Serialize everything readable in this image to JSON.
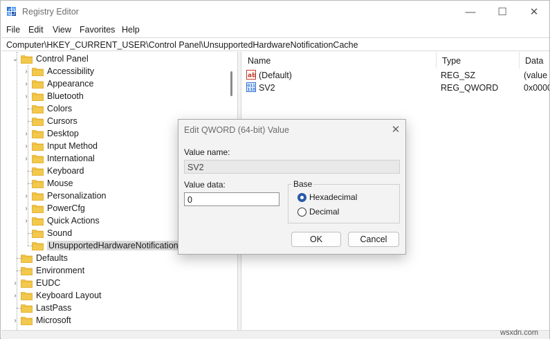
{
  "window": {
    "title": "Registry Editor",
    "controls": {
      "minimize": "—",
      "maximize": "☐",
      "close": "✕"
    }
  },
  "menu": [
    "File",
    "Edit",
    "View",
    "Favorites",
    "Help"
  ],
  "address": "Computer\\HKEY_CURRENT_USER\\Control Panel\\UnsupportedHardwareNotificationCache",
  "tree": {
    "parent": "Control Panel",
    "children": [
      {
        "label": "Accessibility",
        "expandable": true
      },
      {
        "label": "Appearance",
        "expandable": true
      },
      {
        "label": "Bluetooth",
        "expandable": true
      },
      {
        "label": "Colors",
        "expandable": false
      },
      {
        "label": "Cursors",
        "expandable": false
      },
      {
        "label": "Desktop",
        "expandable": true
      },
      {
        "label": "Input Method",
        "expandable": true
      },
      {
        "label": "International",
        "expandable": true
      },
      {
        "label": "Keyboard",
        "expandable": false
      },
      {
        "label": "Mouse",
        "expandable": false
      },
      {
        "label": "Personalization",
        "expandable": true
      },
      {
        "label": "PowerCfg",
        "expandable": true
      },
      {
        "label": "Quick Actions",
        "expandable": true
      },
      {
        "label": "Sound",
        "expandable": false
      },
      {
        "label": "UnsupportedHardwareNotificationC",
        "expandable": false,
        "selected": true
      }
    ],
    "siblings": [
      {
        "label": "Defaults",
        "expandable": false
      },
      {
        "label": "Environment",
        "expandable": false
      },
      {
        "label": "EUDC",
        "expandable": true
      },
      {
        "label": "Keyboard Layout",
        "expandable": true
      },
      {
        "label": "LastPass",
        "expandable": false
      },
      {
        "label": "Microsoft",
        "expandable": true
      }
    ]
  },
  "values_pane": {
    "headers": {
      "name": "Name",
      "type": "Type",
      "data": "Data"
    },
    "rows": [
      {
        "icon": "string-value-icon",
        "name": "(Default)",
        "type": "REG_SZ",
        "data": "(value"
      },
      {
        "icon": "binary-value-icon",
        "name": "SV2",
        "type": "REG_QWORD",
        "data": "0x0000"
      }
    ]
  },
  "dialog": {
    "title": "Edit QWORD (64-bit) Value",
    "value_name_label": "Value name:",
    "value_name": "SV2",
    "value_data_label": "Value data:",
    "value_data": "0",
    "base_label": "Base",
    "base_options": [
      {
        "label": "Hexadecimal",
        "checked": true
      },
      {
        "label": "Decimal",
        "checked": false
      }
    ],
    "ok_label": "OK",
    "cancel_label": "Cancel"
  },
  "watermark": "wsxdn.com",
  "colors": {
    "folder": "#f2c94c",
    "folder_dark": "#e0a826",
    "accent": "#2a5ba8"
  }
}
